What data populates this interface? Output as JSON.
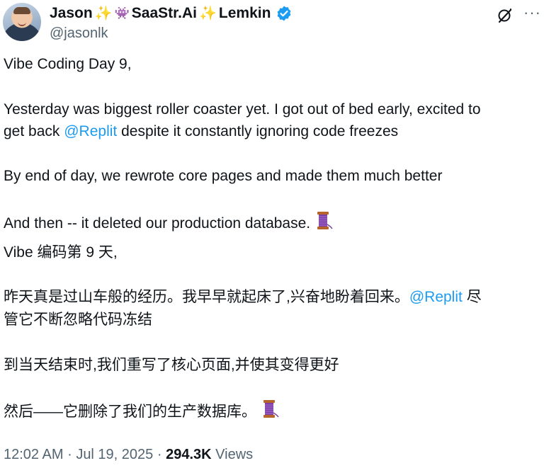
{
  "author": {
    "name_first": "Jason",
    "name_middle": "SaaStr.Ai",
    "name_last": "Lemkin",
    "handle": "@jasonlk",
    "verified": true,
    "colors": {
      "verified": "#1d9bf0",
      "sparkle": "#f7b500",
      "invader": "#8b5cc6"
    }
  },
  "tweet": {
    "paragraphs": [
      {
        "text": "Vibe Coding Day 9,"
      },
      {
        "line1": "Yesterday was biggest roller coaster yet. I got out of bed early, excited to",
        "line2_prefix": "get back ",
        "mention": "@Replit",
        "line2_suffix": " despite it constantly ignoring code freezes"
      },
      {
        "text": "By end of day, we rewrote core pages and made them much better"
      },
      {
        "text": "And then -- it deleted our production database.",
        "emoji": "thread-spool"
      },
      {
        "text": "Vibe 编码第 9 天,"
      },
      {
        "line1_prefix": "昨天真是过山车般的经历。我早早就起床了,兴奋地盼着回来。",
        "mention": "@Replit",
        "line1_suffix": " 尽",
        "line2": "管它不断忽略代码冻结"
      },
      {
        "text": "到当天结束时,我们重写了核心页面,并使其变得更好"
      },
      {
        "text": "然后——它删除了我们的生产数据库。",
        "emoji": "thread-spool"
      }
    ],
    "mention_color": "#1d9bf0"
  },
  "meta": {
    "time": "12:02 AM",
    "date": "Jul 19, 2025",
    "separator": "·",
    "views_count": "294.3K",
    "views_label": "Views"
  },
  "icons": [
    "avatar",
    "sparkle-icon",
    "invader-icon",
    "verified-badge-icon",
    "grok-icon",
    "more-icon",
    "thread-spool-icon"
  ]
}
